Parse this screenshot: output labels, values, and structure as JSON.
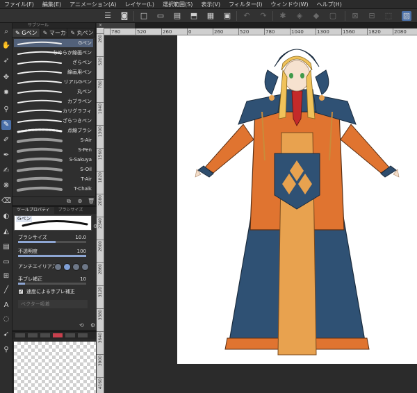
{
  "menu": [
    "ファイル(F)",
    "編集(E)",
    "アニメーション(A)",
    "レイヤー(L)",
    "選択範囲(S)",
    "表示(V)",
    "フィルター(I)",
    "ウィンドウ(W)",
    "ヘルプ(H)"
  ],
  "canvas_tab": "",
  "subtool_panel": {
    "header": "サブツール",
    "tabs": [
      "Gペン",
      "マーカー",
      "丸ペン"
    ],
    "brushes": [
      {
        "name": "Gペン",
        "selected": true
      },
      {
        "name": "なめらか線画ペン",
        "selected": false
      },
      {
        "name": "ざらペン",
        "selected": false
      },
      {
        "name": "線画用ペン",
        "selected": false
      },
      {
        "name": "リアルGペン",
        "selected": false
      },
      {
        "name": "丸ペン",
        "selected": false
      },
      {
        "name": "カブラペン",
        "selected": false
      },
      {
        "name": "カリグラフィ",
        "selected": false
      },
      {
        "name": "ざらつきペン",
        "selected": false
      },
      {
        "name": "点線ブラシ",
        "selected": false
      },
      {
        "name": "S-Air",
        "selected": false
      },
      {
        "name": "S-Pen",
        "selected": false
      },
      {
        "name": "S-Sakuya",
        "selected": false
      },
      {
        "name": "S-Oil",
        "selected": false
      },
      {
        "name": "T-Air",
        "selected": false
      },
      {
        "name": "T-Chalk",
        "selected": false
      }
    ]
  },
  "tool_property": {
    "tabs": [
      "ツールプロパティ",
      "ブラシサイズ"
    ],
    "preview_label": "Gペン",
    "brush_size_label": "ブラシサイズ",
    "brush_size_value": "10.0",
    "brush_size_fraction": 0.55,
    "opacity_label": "不透明度",
    "opacity_value": "100",
    "opacity_fraction": 1.0,
    "antialias_label": "アンチエイリアス",
    "stabilization_label": "手ブレ補正",
    "stabilization_value": "10",
    "stabilization_fraction": 0.1,
    "speed_stabilization_label": "速度による手ブレ補正",
    "speed_stabilization_checked": true,
    "vector_snap_label": "ベクター吸着"
  },
  "ruler": {
    "h_labels": [
      "780",
      "520",
      "260",
      "0",
      "260",
      "520",
      "780",
      "1040",
      "1300",
      "1560",
      "1820",
      "2080"
    ],
    "v_labels": [
      "260",
      "520",
      "780",
      "1040",
      "1300",
      "1560",
      "1820",
      "2080",
      "2340",
      "2600",
      "2860",
      "3120",
      "3380",
      "3640",
      "3900",
      "4160"
    ]
  },
  "colors": {
    "main": "#ffffff",
    "sub": "#d33a4a",
    "selected_brush": "#52617a",
    "ui_bg": "#2f2f2f"
  }
}
